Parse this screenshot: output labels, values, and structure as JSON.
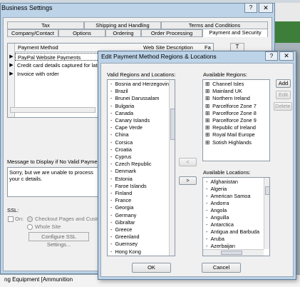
{
  "business_settings": {
    "title": "Business Settings",
    "help_icon": "?",
    "close_icon": "✕",
    "tabs_row1": [
      "Tax",
      "Shipping and Handling",
      "Terms and Conditions"
    ],
    "tabs_row2": [
      "Company/Contact",
      "Options",
      "Ordering",
      "Order Processing",
      "Payment and Security"
    ],
    "grid": {
      "col_method": "Payment Method",
      "col_desc": "Web Site Description",
      "col_fa": "Fa",
      "rows": [
        "PayPal Website Payments",
        "Credit card details captured for later proc",
        "Invoice with order"
      ]
    },
    "side_button": "T",
    "msg_label": "Message to Display if No Valid Payment Me",
    "msg_text": "Sorry, but we are unable to process your c details.",
    "ssl_label": "SSL:",
    "ssl_on": "On:",
    "ssl_checkout": "Checkout Pages and Custome",
    "ssl_whole": "Whole Site",
    "ssl_button": "Configure SSL Settings..."
  },
  "dialog": {
    "title": "Edit Payment Method Regions & Locations",
    "help_icon": "?",
    "close_icon": "✕",
    "valid_label": "Valid Regions and Locations:",
    "valid_items": [
      "Bosnia and Herzegovin",
      "Brazil",
      "Brunei Darussalam",
      "Bulgaria",
      "Canada",
      "Canary Islands",
      "Cape Verde",
      "China",
      "Corsica",
      "Croatia",
      "Cyprus",
      "Czech Republic",
      "Denmark",
      "Estonia",
      "Faroe Islands",
      "Finland",
      "France",
      "Georgia",
      "Germany",
      "Gibraltar",
      "Greece",
      "Greenland",
      "Guernsey",
      "Hong Kong"
    ],
    "available_regions_label": "Available Regions:",
    "available_regions": [
      "Channel Isles",
      "Mainland UK",
      "Northern Ireland",
      "Parcelforce Zone 7",
      "Parcelforce Zone 8",
      "Parcelforce Zone 9",
      "Republic of Ireland",
      "Royal Mail Europe",
      "Sotish Highlands"
    ],
    "available_locations_label": "Available Locations:",
    "available_locations": [
      "Afghanistan",
      "Algeria",
      "American Samoa",
      "Andorra",
      "Angola",
      "Anguilla",
      "Antarctica",
      "Antigua and Barbuda",
      "Aruba",
      "Azerbaijan"
    ],
    "add_button": "Add",
    "edit_button": "Edit",
    "delete_button": "Delete",
    "move_left": "<",
    "move_right": ">",
    "ok_button": "OK",
    "cancel_button": "Cancel"
  },
  "taskbar_text": "ng Equipment [Ammunition"
}
